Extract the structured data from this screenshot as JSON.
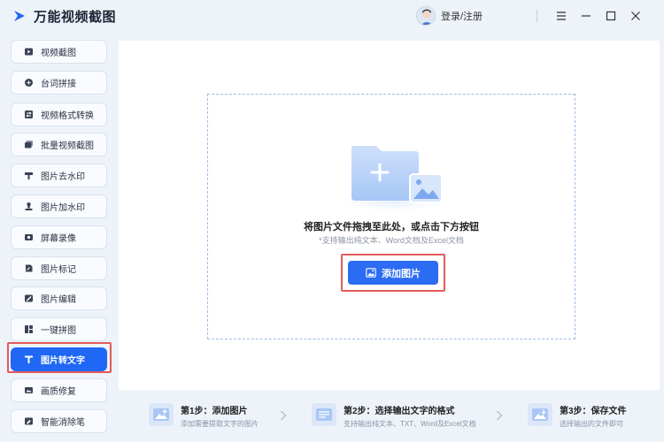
{
  "app": {
    "title": "万能视频截图",
    "login_label": "登录/注册"
  },
  "window_controls": [
    "menu-icon",
    "minimize-icon",
    "maximize-icon",
    "close-icon"
  ],
  "sidebar": {
    "items": [
      {
        "label": "视频截图",
        "icon": "video-screenshot-icon"
      },
      {
        "label": "台词拼接",
        "icon": "subtitle-stitch-icon"
      },
      {
        "label": "视频格式转换",
        "icon": "format-convert-icon"
      },
      {
        "label": "批量视频截图",
        "icon": "batch-screenshot-icon"
      },
      {
        "label": "图片去水印",
        "icon": "remove-watermark-icon"
      },
      {
        "label": "图片加水印",
        "icon": "add-watermark-icon"
      },
      {
        "label": "屏幕录像",
        "icon": "screen-record-icon"
      },
      {
        "label": "图片标记",
        "icon": "image-mark-icon"
      },
      {
        "label": "图片编辑",
        "icon": "image-edit-icon"
      },
      {
        "label": "一键拼图",
        "icon": "collage-icon"
      },
      {
        "label": "图片转文字",
        "icon": "text-t-icon",
        "active": true
      },
      {
        "label": "画质修复",
        "icon": "quality-repair-icon"
      },
      {
        "label": "智能消除笔",
        "icon": "eraser-pen-icon"
      }
    ]
  },
  "dropzone": {
    "title": "将图片文件拖拽至此处，或点击下方按钮",
    "subtitle": "*支持输出纯文本、Word文档及Excel文档",
    "button_label": "添加图片"
  },
  "steps": [
    {
      "title": "第1步：添加图片",
      "desc": "添加需要提取文字的图片"
    },
    {
      "title": "第2步：选择输出文字的格式",
      "desc": "支持输出纯文本、TXT、Word及Excel文档"
    },
    {
      "title": "第3步：保存文件",
      "desc": "选择输出的文件即可"
    }
  ],
  "colors": {
    "accent": "#2c6cf2",
    "highlight_frame": "#e45a5a"
  }
}
